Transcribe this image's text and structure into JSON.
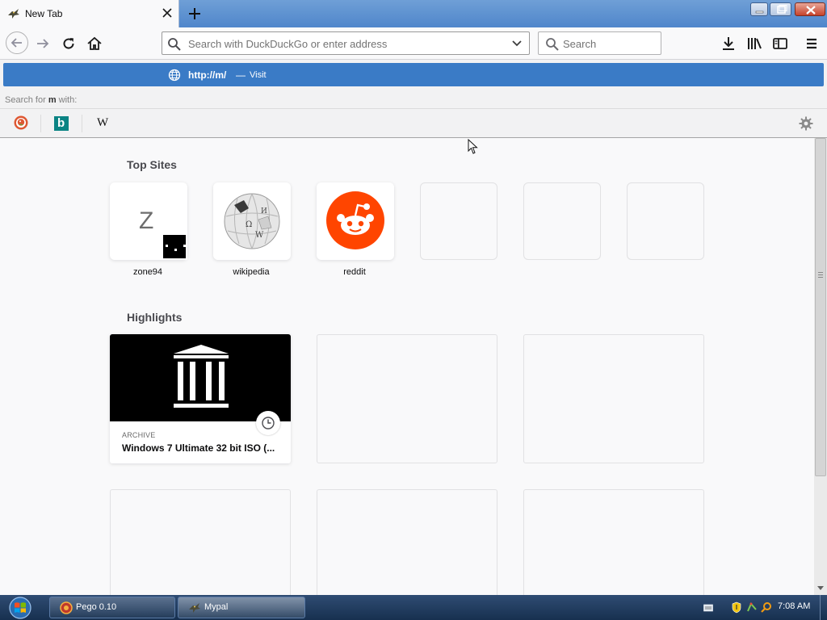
{
  "tab": {
    "title": "New Tab",
    "favicon": "mypal-bird-icon"
  },
  "toolbar": {
    "address_placeholder": "Search with DuckDuckGo or enter address",
    "search_placeholder": "Search"
  },
  "popup": {
    "heuristic_url": "http://m/",
    "heuristic_sep": "—",
    "heuristic_action": "Visit",
    "search_for_prefix": "Search for",
    "search_for_term": "m",
    "search_for_suffix": "with:",
    "engines": [
      {
        "name": "DuckDuckGo",
        "icon": "duckduckgo-icon"
      },
      {
        "name": "Bing",
        "icon": "bing-icon",
        "glyph": "b"
      },
      {
        "name": "Wikipedia",
        "icon": "wikipedia-icon",
        "glyph": "W"
      }
    ]
  },
  "content": {
    "top_sites_title": "Top Sites",
    "top_sites": [
      {
        "label": "zone94",
        "letter": "Z"
      },
      {
        "label": "wikipedia"
      },
      {
        "label": "reddit"
      }
    ],
    "highlights_title": "Highlights",
    "highlights": [
      {
        "source": "ARCHIVE",
        "title": "Windows 7 Ultimate 32 bit ISO (..."
      }
    ]
  },
  "taskbar": {
    "tasks": [
      {
        "label": "Pego 0.10",
        "icon": "pego-icon"
      },
      {
        "label": "Mypal",
        "icon": "mypal-bird-icon"
      }
    ],
    "clock": "7:08 AM"
  },
  "colors": {
    "accent_blue": "#3a7bc6",
    "reddit_orange": "#ff4500",
    "taskbar": "#1d3a5e"
  }
}
